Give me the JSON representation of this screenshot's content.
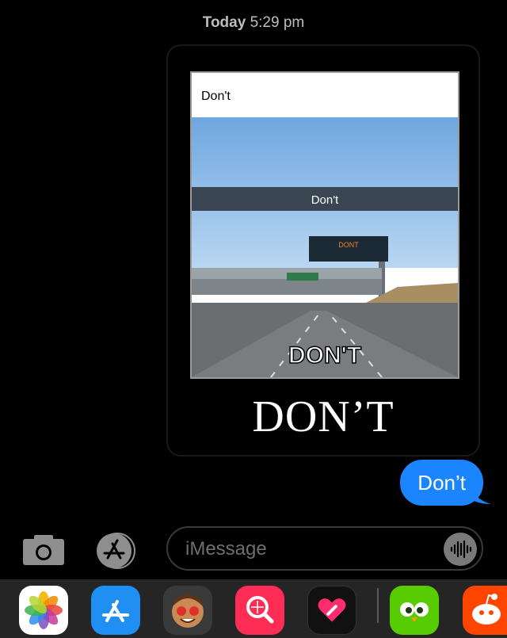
{
  "header": {
    "day": "Today",
    "time": "5:29 pm"
  },
  "received_message": {
    "meme": {
      "top_text": "Don't",
      "middle_text": "Don't",
      "sign_text": "DONT",
      "bottom_text": "DON'T",
      "caption": "DON’T"
    }
  },
  "sent_message": {
    "text": "Don’t",
    "color": "#1a85ff"
  },
  "composer": {
    "placeholder": "iMessage",
    "camera_icon": "camera-icon",
    "apps_icon": "app-store-icon",
    "audio_icon": "waveform-icon"
  },
  "app_drawer": {
    "apps": [
      {
        "name": "photos-icon"
      },
      {
        "name": "app-store-icon"
      },
      {
        "name": "memoji-icon"
      },
      {
        "name": "images-search-icon"
      },
      {
        "name": "digital-touch-icon"
      },
      {
        "name": "duolingo-icon"
      },
      {
        "name": "reddit-icon"
      }
    ]
  }
}
